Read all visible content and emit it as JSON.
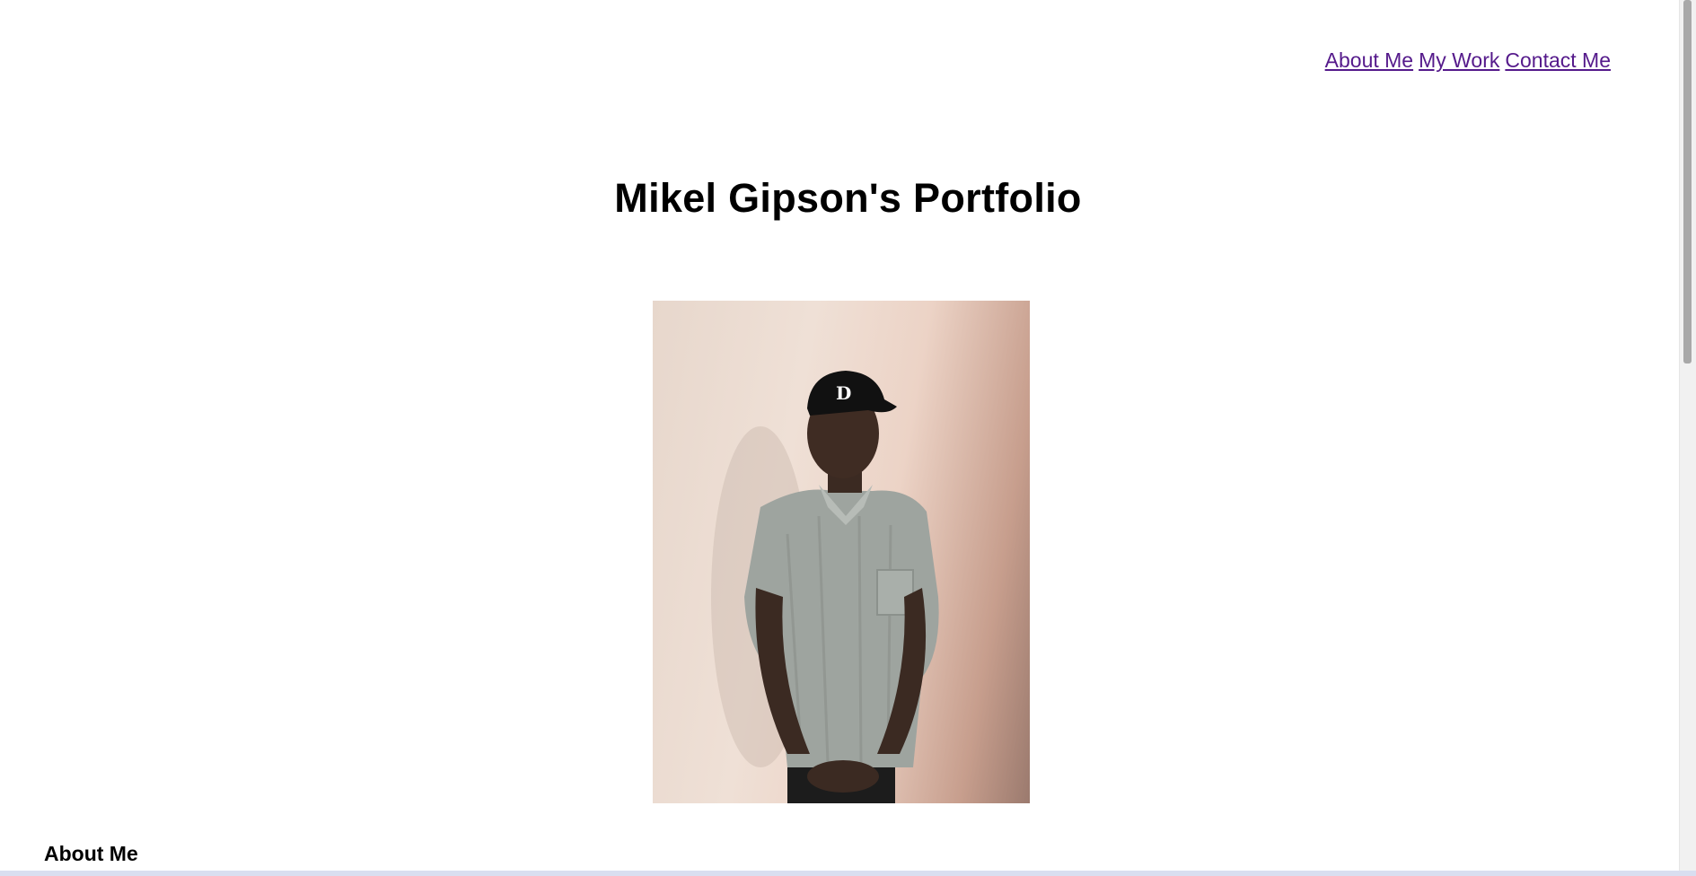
{
  "nav": {
    "links": [
      {
        "label": "About Me"
      },
      {
        "label": "My Work"
      },
      {
        "label": "Contact Me"
      }
    ]
  },
  "header": {
    "title": "Mikel Gipson's Portfolio"
  },
  "profile_photo": {
    "alt": "Portrait photo"
  },
  "about": {
    "heading": "About Me"
  },
  "colors": {
    "link": "#551a8b",
    "text": "#000000",
    "background": "#ffffff"
  }
}
